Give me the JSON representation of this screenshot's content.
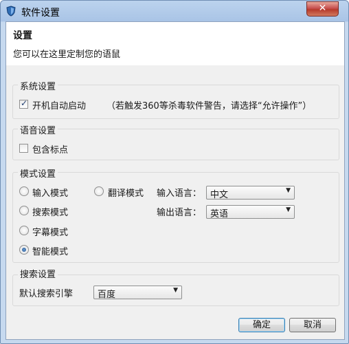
{
  "window": {
    "title": "软件设置",
    "close_label": "✕"
  },
  "header": {
    "title": "设置",
    "description": "您可以在这里定制您的语鼠"
  },
  "system": {
    "title": "系统设置",
    "autostart_label": "开机自动启动",
    "autostart_checked": true,
    "note": "（若触发360等杀毒软件警告，请选择“允许操作”）"
  },
  "voice": {
    "title": "语音设置",
    "punctuation_label": "包含标点",
    "punctuation_checked": false
  },
  "mode": {
    "title": "模式设置",
    "options": [
      "输入模式",
      "翻译模式",
      "搜索模式",
      "字幕模式",
      "智能模式"
    ],
    "selected": "智能模式",
    "input_lang_label": "输入语言：",
    "input_lang_value": "中文",
    "output_lang_label": "输出语言：",
    "output_lang_value": "英语"
  },
  "search": {
    "title": "搜索设置",
    "engine_label": "默认搜索引擎",
    "engine_value": "百度"
  },
  "buttons": {
    "ok": "确定",
    "cancel": "取消"
  },
  "icons": {
    "app": "shield-icon",
    "close": "close-icon",
    "checkmark": "✓",
    "dropdown": "▼"
  },
  "colors": {
    "title_bar": "#a9c4e6",
    "close_button": "#c75050",
    "radio_selected": "#1f4f8c"
  }
}
